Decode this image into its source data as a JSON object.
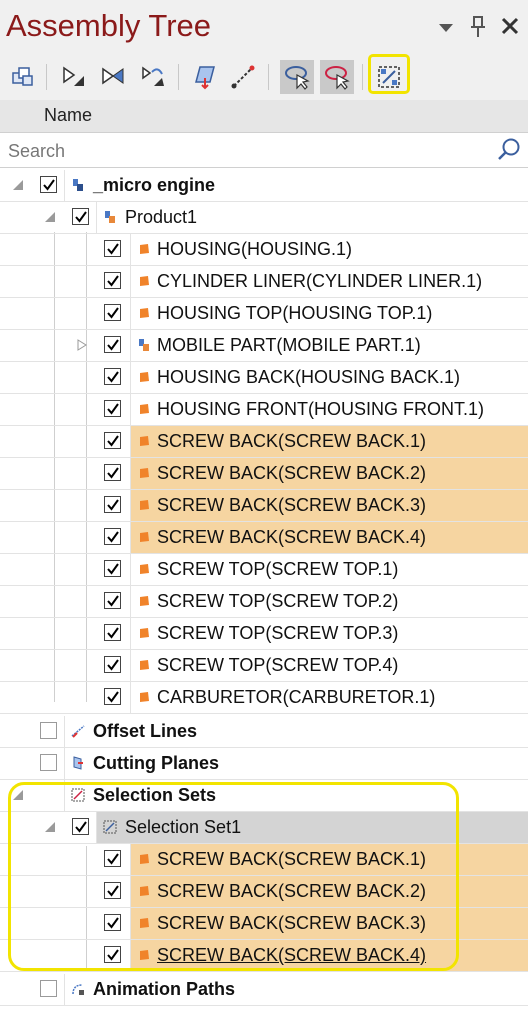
{
  "panel": {
    "title": "Assembly Tree",
    "column_header": "Name",
    "search_placeholder": "Search"
  },
  "toolbar": {
    "buttons": [
      "assembly-icon",
      "hide-icon",
      "show-icon",
      "swap-visibility-icon",
      "section-plane-icon",
      "measure-icon",
      "select-region-icon",
      "deselect-region-icon",
      "selection-set-icon"
    ]
  },
  "colors": {
    "title": "#8b1a1a",
    "highlight_row": "#f6d5a1",
    "selected_row": "#d4d4d4",
    "callout": "#f2e400"
  },
  "tree": {
    "root": "_micro engine",
    "product": "Product1",
    "parts": [
      "HOUSING(HOUSING.1)",
      "CYLINDER LINER(CYLINDER LINER.1)",
      "HOUSING TOP(HOUSING TOP.1)",
      "MOBILE PART(MOBILE PART.1)",
      "HOUSING BACK(HOUSING BACK.1)",
      "HOUSING FRONT(HOUSING FRONT.1)",
      "SCREW BACK(SCREW BACK.1)",
      "SCREW BACK(SCREW BACK.2)",
      "SCREW BACK(SCREW BACK.3)",
      "SCREW BACK(SCREW BACK.4)",
      "SCREW TOP(SCREW TOP.1)",
      "SCREW TOP(SCREW TOP.2)",
      "SCREW TOP(SCREW TOP.3)",
      "SCREW TOP(SCREW TOP.4)",
      "CARBURETOR(CARBURETOR.1)"
    ],
    "offset_lines": "Offset Lines",
    "cutting_planes": "Cutting Planes",
    "selection_sets": "Selection Sets",
    "selection_set1": "Selection Set1",
    "set_members": [
      "SCREW BACK(SCREW BACK.1)",
      "SCREW BACK(SCREW BACK.2)",
      "SCREW BACK(SCREW BACK.3)",
      "SCREW BACK(SCREW BACK.4)"
    ],
    "animation_paths": "Animation Paths"
  }
}
